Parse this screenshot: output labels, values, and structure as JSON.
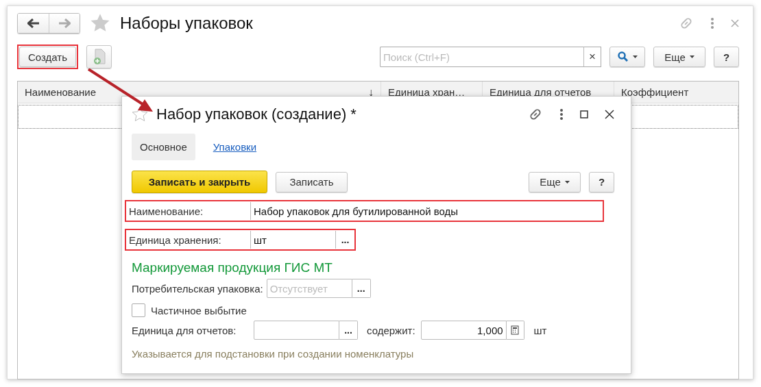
{
  "window": {
    "title": "Наборы упаковок",
    "favorite": false
  },
  "toolbar": {
    "create_button": {
      "label": "Создать",
      "highlighted": true
    },
    "search": {
      "placeholder": "Поиск (Ctrl+F)",
      "clear": "×"
    },
    "more_button": "Еще",
    "help_button": "?"
  },
  "table": {
    "columns": [
      {
        "label": "Наименование",
        "sort": "↓"
      },
      {
        "label": "Единица хран…"
      },
      {
        "label": "Единица для отчетов"
      },
      {
        "label": "Коэффициент"
      }
    ]
  },
  "annotation_arrow": true,
  "dialog": {
    "title": "Набор упаковок (создание) *",
    "favorite": false,
    "tabs": [
      {
        "label": "Основное",
        "selected": true
      },
      {
        "label": "Упаковки",
        "selected": false
      }
    ],
    "buttons": {
      "save_close": "Записать и закрыть",
      "save": "Записать",
      "more": "Еще",
      "help": "?"
    },
    "name_field": {
      "label": "Наименование:",
      "value": "Набор упаковок для бутилированной воды",
      "highlighted": true
    },
    "unit_field": {
      "label": "Единица хранения:",
      "value": "шт",
      "choose": "...",
      "highlighted": true
    },
    "section_title": "Маркируемая продукция ГИС МТ",
    "consumer_pack": {
      "label": "Потребительская упаковка:",
      "placeholder": "Отсутствует",
      "choose": "..."
    },
    "partial_checkbox": {
      "label": "Частичное выбытие",
      "checked": false
    },
    "report_unit": {
      "label": "Единица для отчетов:",
      "choose": "...",
      "contains_label": "содержит:",
      "contains_value": "1,000",
      "unit": "шт"
    },
    "hint": "Указывается для подстановки при создании номенклатуры"
  }
}
